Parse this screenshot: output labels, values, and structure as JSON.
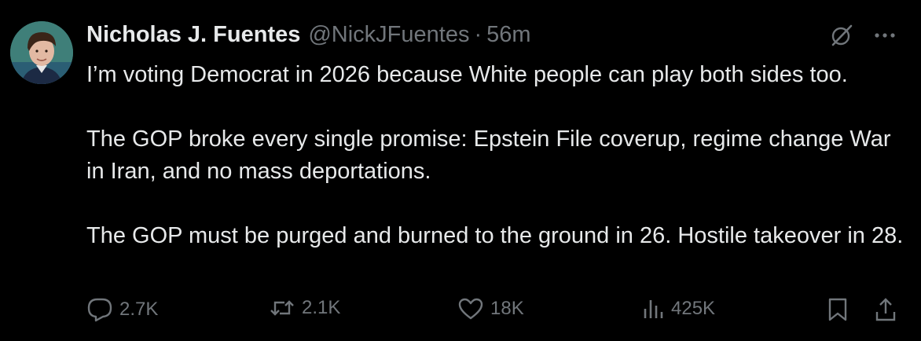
{
  "author": {
    "display_name": "Nicholas J. Fuentes",
    "handle": "@NickJFuentes",
    "separator": "·",
    "time": "56m"
  },
  "tweet": {
    "paragraphs": [
      "I’m voting Democrat in 2026 because White people can play both sides too.",
      "The GOP broke every single promise: Epstein File coverup, regime change War in Iran, and no mass deportations.",
      "The GOP must be purged and burned to the ground in 26. Hostile takeover in 28."
    ]
  },
  "actions": {
    "replies": "2.7K",
    "reposts": "2.1K",
    "likes": "18K",
    "views": "425K"
  },
  "icons": {
    "reply": "reply-icon",
    "repost": "repost-icon",
    "like": "heart-icon",
    "views": "views-chart-icon",
    "bookmark": "bookmark-icon",
    "share": "share-icon",
    "grok": "grok-icon",
    "more": "more-icon"
  },
  "colors": {
    "background": "#000000",
    "primary_text": "#e7e9ea",
    "secondary_text": "#71767b"
  }
}
